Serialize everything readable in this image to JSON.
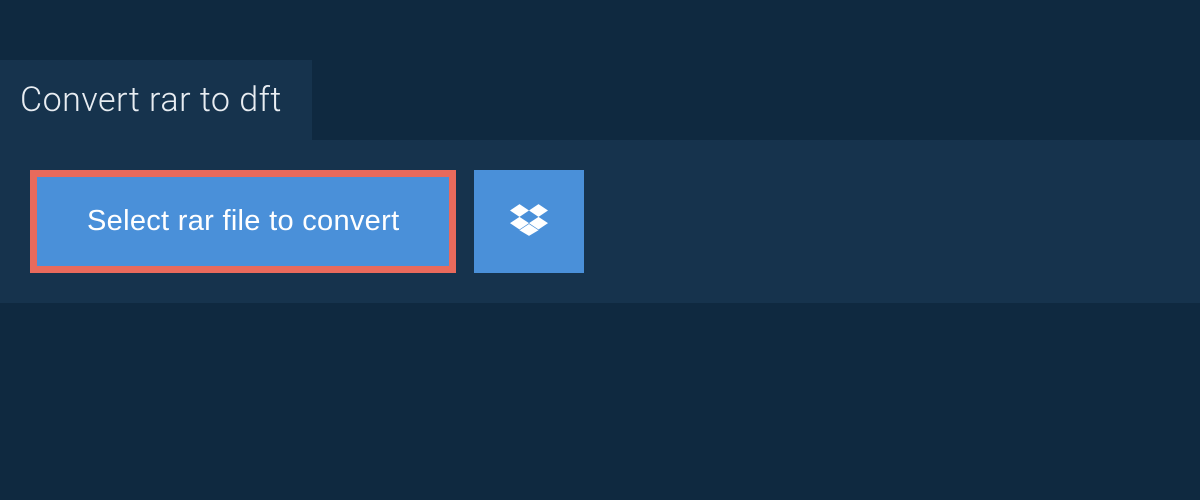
{
  "header": {
    "title": "Convert rar to dft"
  },
  "actions": {
    "selectFileLabel": "Select rar file to convert",
    "dropboxIcon": "dropbox-icon"
  },
  "colors": {
    "pageBg": "#0f2940",
    "panelBg": "#16334d",
    "buttonBg": "#4a90d9",
    "highlightBorder": "#e86a5c",
    "textLight": "#e8edf2",
    "textWhite": "#ffffff"
  }
}
